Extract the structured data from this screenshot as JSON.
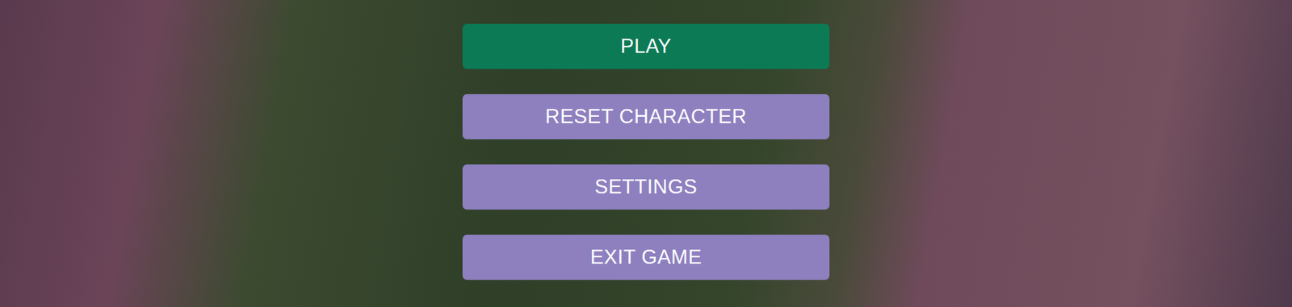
{
  "menu": {
    "buttons": [
      {
        "label": "PLAY",
        "selected": true
      },
      {
        "label": "RESET CHARACTER",
        "selected": false
      },
      {
        "label": "SETTINGS",
        "selected": false
      },
      {
        "label": "EXIT GAME",
        "selected": false
      }
    ]
  }
}
